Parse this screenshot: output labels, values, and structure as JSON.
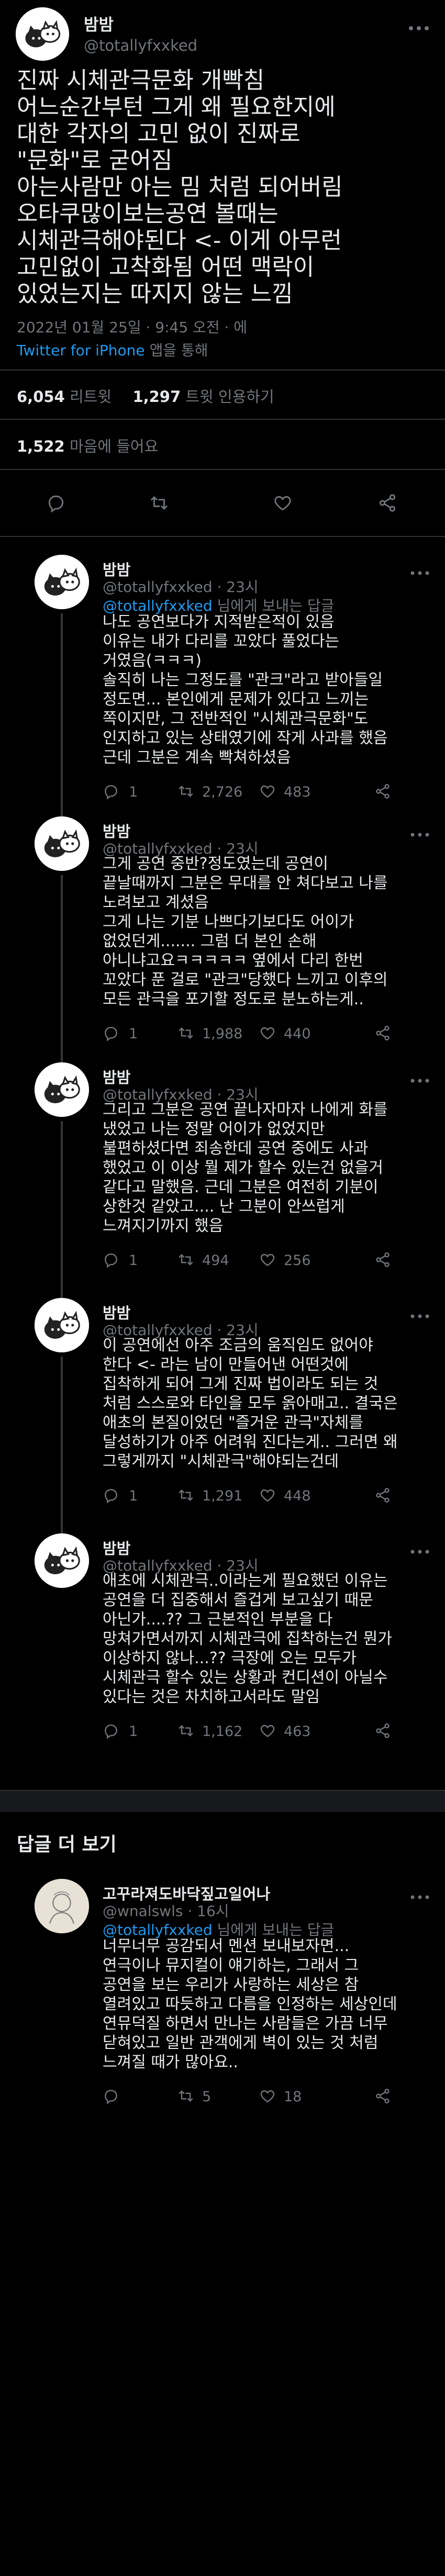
{
  "main_tweet": {
    "author_name": "밤밤",
    "author_handle": "@totallyfxxked",
    "lines": [
      "진짜 시체관극문화 개빡침",
      "어느순간부턴 그게 왜 필요한지에",
      "대한 각자의 고민 없이 진짜로",
      "\"문화\"로 굳어짐",
      "아는사람만 아는 밈 처럼 되어버림",
      "오타쿠많이보는공연 볼때는",
      "시체관극해야된다 <- 이게 아무런",
      "고민없이 고착화됨 어떤 맥락이",
      "있었는지는 따지지 않는 느낌"
    ],
    "timestamp": "2022년 01월 25일 · 9:45 오전 · 에",
    "source_app": "Twitter for iPhone",
    "source_suffix": " 앱을 통해",
    "retweets_count": "6,054",
    "retweets_label": " 리트윗",
    "quotes_count": "1,297",
    "quotes_label": " 트윗 인용하기",
    "likes_count": "1,522",
    "likes_label": " 마음에 들어요"
  },
  "replies": [
    {
      "author_name": "밤밤",
      "author_handle": "@totallyfxxked",
      "time": "· 23시",
      "replying_to_handle": "@totallyfxxked",
      "replying_to_suffix": " 님에게 보내는 답글",
      "lines": [
        "나도 공연보다가 지적받은적이 있음",
        "이유는 내가 다리를 꼬았다 풀었다는",
        "거였음(ㅋㅋㅋ)",
        "솔직히 나는 그정도를 \"관크\"라고 받아들일",
        "정도면... 본인에게 문제가 있다고 느끼는",
        "쪽이지만, 그 전반적인 \"시체관극문화\"도",
        "인지하고 있는 상태였기에 작게 사과를 했음",
        "근데 그분은 계속 빡쳐하셨음"
      ],
      "reply_count": "1",
      "retweet_count": "2,726",
      "like_count": "483"
    },
    {
      "author_name": "밤밤",
      "author_handle": "@totallyfxxked",
      "time": "· 23시",
      "lines": [
        "그게 공연 중반?정도였는데 공연이",
        "끝날때까지 그분은 무대를 안 쳐다보고 나를",
        "노려보고 계셨음",
        "그게 나는 기분 나쁘다기보다도 어이가",
        "없었던게....... 그럼 더 본인 손해",
        "아니냐고요ㅋㅋㅋㅋㅋ 옆에서 다리 한번",
        "꼬았다 푼 걸로 \"관크\"당했다 느끼고 이후의",
        "모든 관극을 포기할 정도로 분노하는게.."
      ],
      "reply_count": "1",
      "retweet_count": "1,988",
      "like_count": "440"
    },
    {
      "author_name": "밤밤",
      "author_handle": "@totallyfxxked",
      "time": "· 23시",
      "lines": [
        "그리고 그분은 공연 끝나자마자 나에게 화를",
        "냈었고 나는 정말 어이가 없었지만",
        "불편하셨다면 죄송한데 공연 중에도 사과",
        "했었고 이 이상 뭘 제가 할수 있는건 없을거",
        "같다고 말했음. 근데 그분은 여전히 기분이",
        "상한것 같았고.... 난 그분이 안쓰럽게",
        "느껴지기까지 했음"
      ],
      "reply_count": "1",
      "retweet_count": "494",
      "like_count": "256"
    },
    {
      "author_name": "밤밤",
      "author_handle": "@totallyfxxked",
      "time": "· 23시",
      "lines": [
        "이 공연에선 아주 조금의 움직임도 없어야",
        "한다 <- 라는 남이 만들어낸 어떤것에",
        "집착하게 되어 그게 진짜 법이라도 되는 것",
        "처럼 스스로와 타인을 모두 옭아매고.. 결국은",
        "애초의 본질이었던 \"즐거운 관극\"자체를",
        "달성하기가 아주 어려워 진다는게.. 그러면 왜",
        "그렇게까지 \"시체관극\"해야되는건데"
      ],
      "reply_count": "1",
      "retweet_count": "1,291",
      "like_count": "448"
    },
    {
      "author_name": "밤밤",
      "author_handle": "@totallyfxxked",
      "time": "· 23시",
      "lines": [
        "애초에 시체관극..이라는게 필요했던 이유는",
        "공연을 더 집중해서 즐겁게 보고싶기 때문",
        "아닌가....?? 그 근본적인 부분을 다",
        "망쳐가면서까지 시체관극에 집착하는건 뭔가",
        "이상하지 않나...?? 극장에 오는 모두가",
        "시체관극 할수 있는 상황과 컨디션이 아닐수",
        "있다는 것은 차치하고서라도 말임"
      ],
      "reply_count": "1",
      "retweet_count": "1,162",
      "like_count": "463"
    }
  ],
  "more_replies_heading": "답글 더 보기",
  "other_reply": {
    "author_name": "고꾸라져도바닥짚고일어나",
    "author_handle": "@wnalswls",
    "time": "· 16시",
    "replying_to_handle": "@totallyfxxked",
    "replying_to_suffix": " 님에게 보내는 답글",
    "lines": [
      "너무너무 공감되서 멘션 보내보자면...",
      "연극이나 뮤지컬이 얘기하는, 그래서 그",
      "공연을 보는 우리가 사랑하는 세상은 참",
      "열려있고 따듯하고 다름을 인정하는 세상인데",
      "연뮤덕질 하면서 만나는 사람들은 가끔 너무",
      "닫혀있고 일반 관객에게 벽이 있는 것 처럼",
      "느껴질 때가 많아요.."
    ],
    "reply_count": "",
    "retweet_count": "5",
    "like_count": "18"
  },
  "colors": {
    "background": "#000000",
    "text": "#e7e9ea",
    "muted": "#71767b",
    "link": "#1d9bf0",
    "divider": "#2f3336"
  }
}
